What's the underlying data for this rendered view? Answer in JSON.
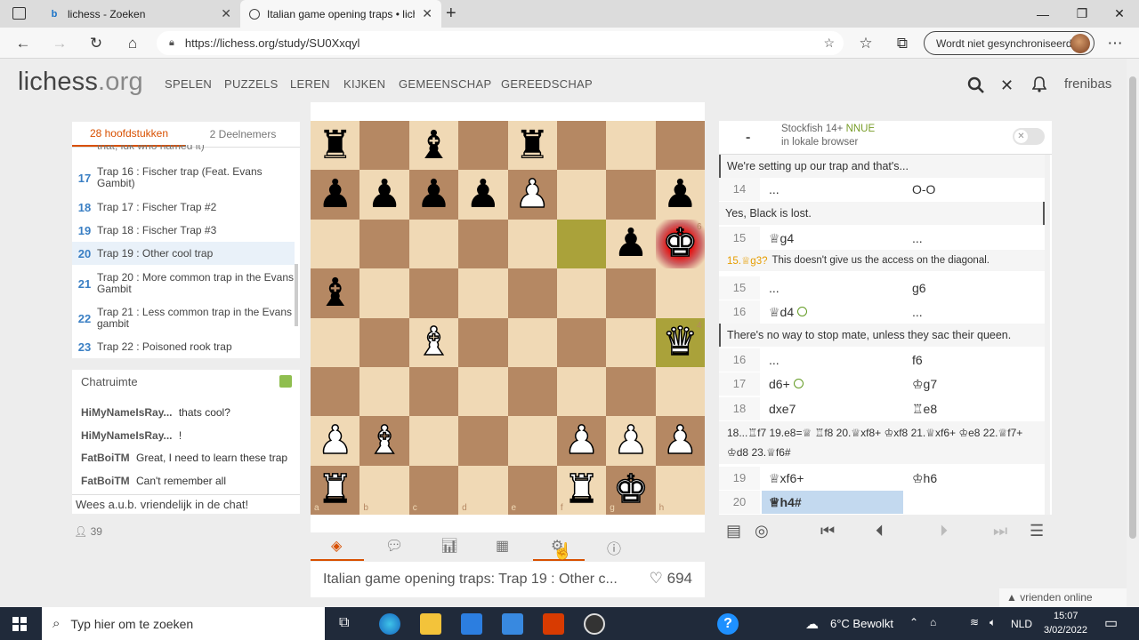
{
  "browser": {
    "tabs": [
      {
        "title": "lichess - Zoeken",
        "close": "✕"
      },
      {
        "title": "Italian game opening traps • lich",
        "close": "✕"
      }
    ],
    "url": "https://lichess.org/study/SU0Xxqyl",
    "sync_label": "Wordt niet gesynchroniseerd"
  },
  "site": {
    "logo": "lichess",
    "logo_suffix": ".org",
    "menu": [
      "SPELEN",
      "PUZZELS",
      "LEREN",
      "KIJKEN",
      "GEMEENSCHAP",
      "GEREEDSCHAP"
    ],
    "username": "frenibas"
  },
  "chapters": {
    "tabs": [
      "28 hoofdstukken",
      "2 Deelnemers"
    ],
    "cut_text": "that, idk who named it)",
    "items": [
      {
        "num": "17",
        "title": "Trap 16 : Fischer trap (Feat. Evans Gambit)"
      },
      {
        "num": "18",
        "title": "Trap 17 : Fischer Trap #2"
      },
      {
        "num": "19",
        "title": "Trap 18 : Fischer Trap #3"
      },
      {
        "num": "20",
        "title": "Trap 19 : Other cool trap"
      },
      {
        "num": "21",
        "title": "Trap 20 : More common trap in the Evans Gambit"
      },
      {
        "num": "22",
        "title": "Trap 21 : Less common trap in the Evans gambit"
      },
      {
        "num": "23",
        "title": "Trap 22 : Poisoned rook trap"
      }
    ]
  },
  "chat": {
    "title": "Chatruimte",
    "messages": [
      {
        "user": "HiMyNameIsRay...",
        "text": "thats cool?"
      },
      {
        "user": "HiMyNameIsRay...",
        "text": "!"
      },
      {
        "user": "FatBoiTM",
        "text": "Great, I need to learn these trap"
      },
      {
        "user": "FatBoiTM",
        "text": "Can't remember all"
      }
    ],
    "placeholder": "Wees a.u.b. vriendelijk in de chat!",
    "viewers": "39"
  },
  "board": {
    "files": [
      "a",
      "b",
      "c",
      "d",
      "e",
      "f",
      "g",
      "h"
    ],
    "ranks": [
      "8",
      "7",
      "6",
      "5",
      "4",
      "3",
      "2",
      "1"
    ]
  },
  "study": {
    "title": "Italian game opening traps: Trap 19 : Other c...",
    "likes": "694"
  },
  "engine": {
    "name": "Stockfish 14+",
    "nnue": "NNUE",
    "location": "in lokale browser",
    "eval": "-"
  },
  "moves": {
    "comment1": "We're setting up our trap and that's...",
    "r14": {
      "num": "14",
      "w": "...",
      "b": "O-O"
    },
    "comment2": "Yes, Black is lost.",
    "r15a": {
      "num": "15",
      "w": "♕g4",
      "b": "..."
    },
    "variation1_move": "15.♕g3?",
    "variation1_text": "This doesn't give us the access on the diagonal.",
    "r15b": {
      "num": "15",
      "w": "...",
      "b": "g6"
    },
    "r16a": {
      "num": "16",
      "w": "♕d4",
      "b": "..."
    },
    "comment3": "There's no way to stop mate, unless they sac their queen.",
    "r16b": {
      "num": "16",
      "w": "...",
      "b": "f6"
    },
    "r17": {
      "num": "17",
      "w": "d6+",
      "b": "♔g7"
    },
    "r18": {
      "num": "18",
      "w": "dxe7",
      "b": "♖e8"
    },
    "variation2": "18...♖f7 19.e8=♕ ♖f8 20.♕xf8+ ♔xf8 21.♕xf6+ ♔e8 22.♕f7+ ♔d8 23.♕f6#",
    "r19": {
      "num": "19",
      "w": "♕xf6+",
      "b": "♔h6"
    },
    "r20": {
      "num": "20",
      "w": "♕h4#",
      "b": ""
    }
  },
  "friends": "▲ vrienden online",
  "taskbar": {
    "search_placeholder": "Typ hier om te zoeken",
    "weather": "6°C  Bewolkt",
    "lang": "NLD",
    "time": "15:07",
    "date": "3/02/2022"
  }
}
